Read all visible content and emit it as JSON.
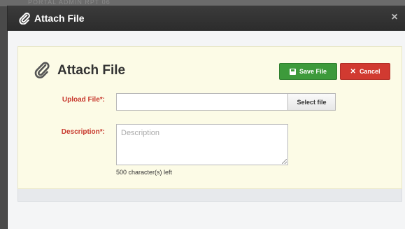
{
  "backdrop": {
    "ghost_text": "PORTAL   ADMIN   RPT 06"
  },
  "modal": {
    "header": {
      "title": "Attach File",
      "icon": "paperclip-icon",
      "close_label": "×",
      "background": "#2f2f2f"
    },
    "form": {
      "title": "Attach File",
      "icon": "paperclip-icon",
      "buttons": {
        "save_label": "Save File",
        "save_icon": "floppy-disk-icon",
        "save_color": "#3d9a3b",
        "cancel_label": "Cancel",
        "cancel_icon": "x-icon",
        "cancel_glyph": "✕",
        "cancel_color": "#d13a31"
      },
      "fields": {
        "upload": {
          "label": "Upload File*:",
          "value": "",
          "button_label": "Select file"
        },
        "description": {
          "label": "Description*:",
          "value": "",
          "placeholder": "Description",
          "helper_text": "500 character(s) left"
        }
      },
      "panel_background": "#fcfbe6",
      "label_color": "#c83a2f"
    }
  }
}
